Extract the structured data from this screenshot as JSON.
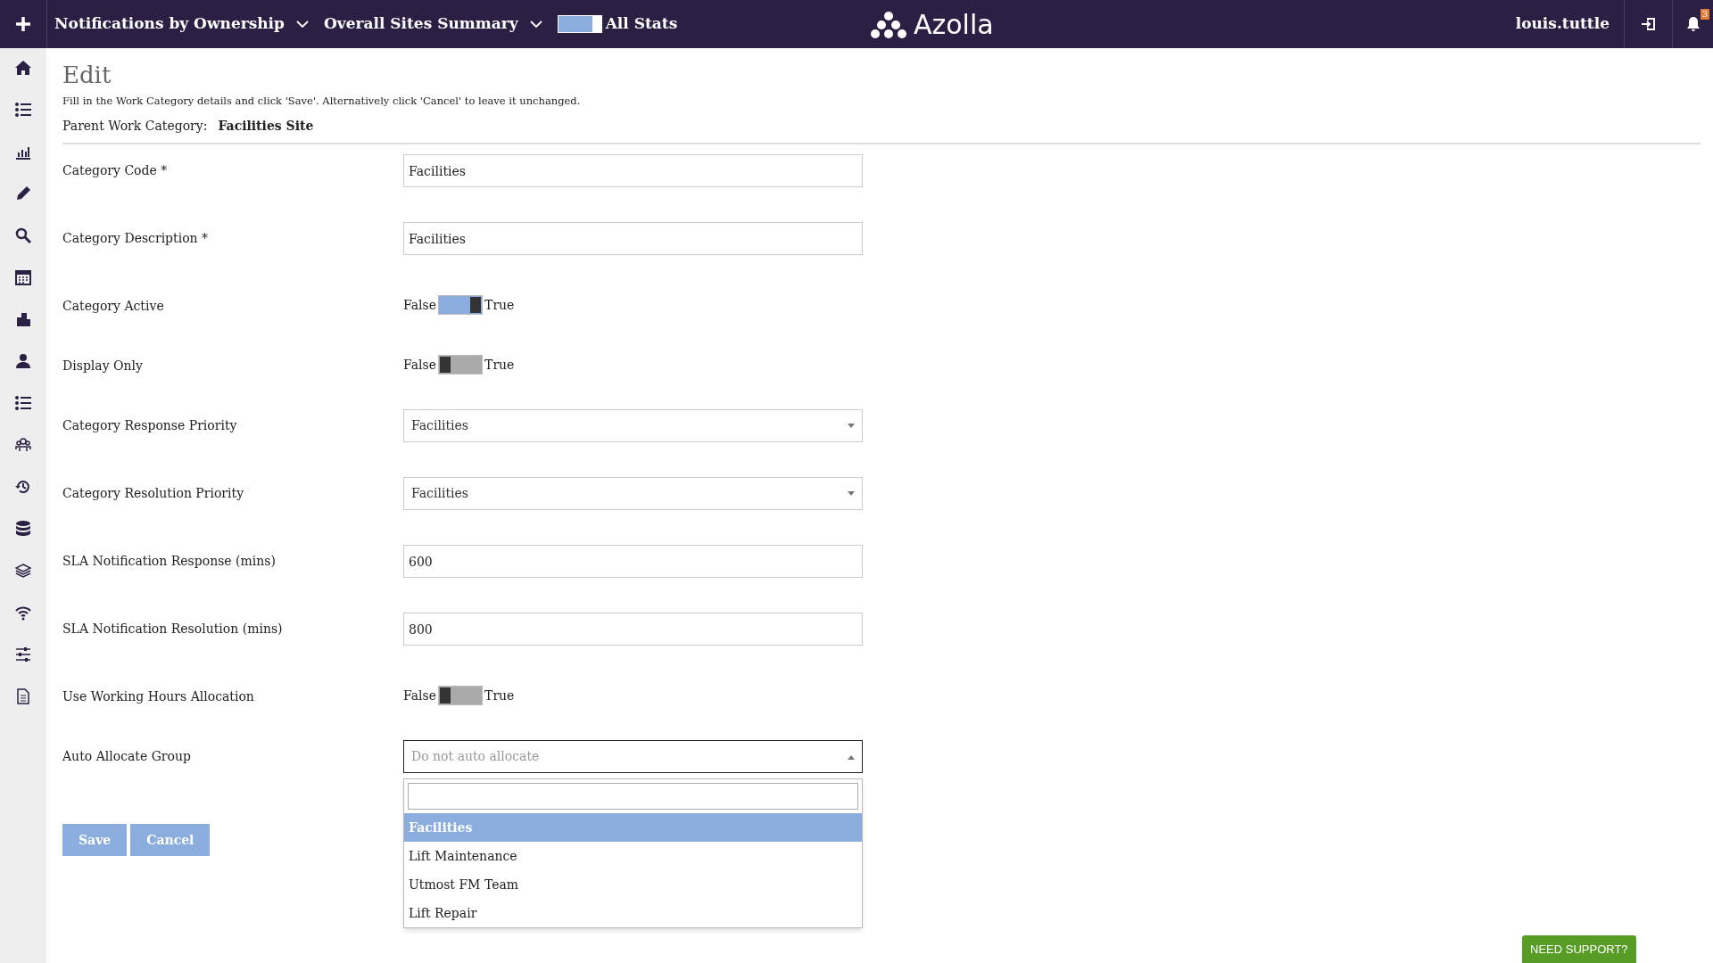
{
  "top_bar": {
    "menus": [
      {
        "label": "Notifications by Ownership"
      },
      {
        "label": "Overall Sites Summary"
      }
    ],
    "stats_toggle": {
      "on": true,
      "label": "All Stats"
    },
    "logo": "Azolla",
    "user": "louis.tuttle",
    "notification_count": "3"
  },
  "page": {
    "title": "Edit",
    "instructions": "Fill in the Work Category details and click 'Save'. Alternatively click 'Cancel' to leave it unchanged.",
    "parent_label": "Parent Work Category:",
    "parent_value": "Facilities Site"
  },
  "fields": [
    {
      "kind": "text",
      "label": "Category Code *",
      "value": "Facilities"
    },
    {
      "kind": "text",
      "label": "Category Description *",
      "value": "Facilities"
    },
    {
      "kind": "toggle",
      "label": "Category Active",
      "off_label": "False",
      "on_label": "True",
      "on": true
    },
    {
      "kind": "toggle",
      "label": "Display Only",
      "off_label": "False",
      "on_label": "True",
      "on": false
    },
    {
      "kind": "select",
      "label": "Category Response Priority",
      "value": "Facilities",
      "open": false
    },
    {
      "kind": "select",
      "label": "Category Resolution Priority",
      "value": "Facilities",
      "open": false
    },
    {
      "kind": "text",
      "label": "SLA Notification Response (mins)",
      "value": "600"
    },
    {
      "kind": "text",
      "label": "SLA Notification Resolution (mins)",
      "value": "800"
    },
    {
      "kind": "toggle",
      "label": "Use Working Hours Allocation",
      "off_label": "False",
      "on_label": "True",
      "on": false
    },
    {
      "kind": "select",
      "label": "Auto Allocate Group",
      "placeholder": "Do not auto allocate",
      "open": true,
      "options": [
        {
          "label": "Facilities",
          "selected": true
        },
        {
          "label": "Lift Maintenance",
          "selected": false
        },
        {
          "label": "Utmost FM Team",
          "selected": false
        },
        {
          "label": "Lift Repair",
          "selected": false
        }
      ]
    }
  ],
  "buttons": [
    "Save",
    "Cancel"
  ],
  "support_button": "NEED SUPPORT?"
}
